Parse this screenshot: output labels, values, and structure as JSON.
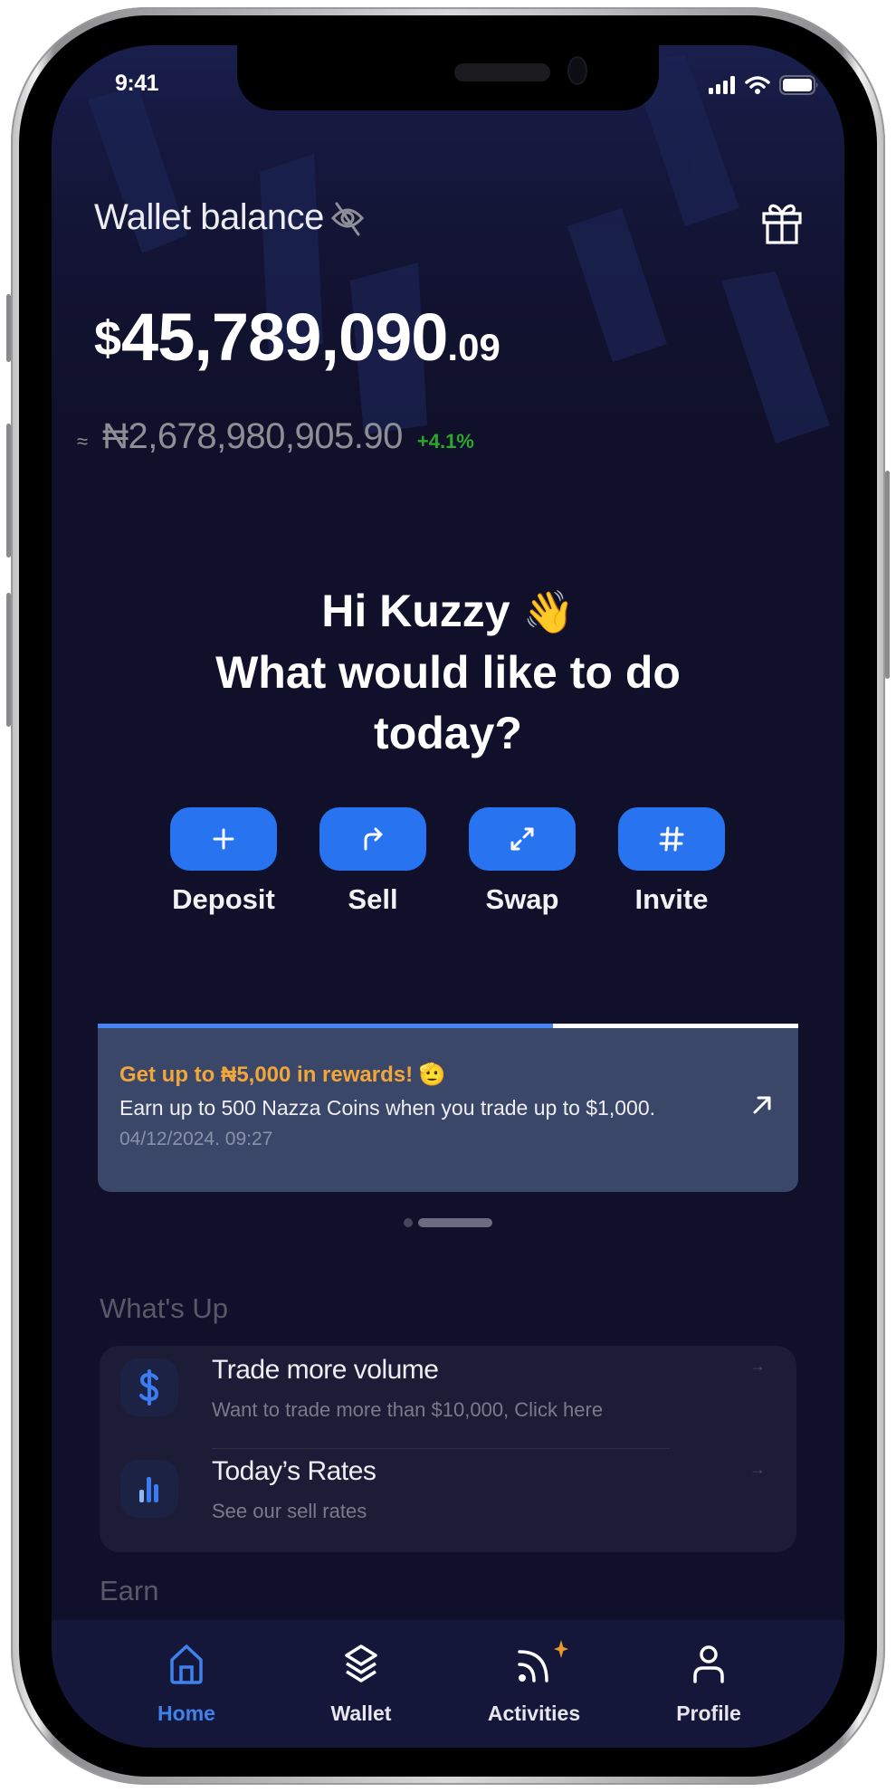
{
  "status_bar": {
    "time": "9:41",
    "icons": [
      "cellular-signal-icon",
      "wifi-icon",
      "battery-icon"
    ]
  },
  "header": {
    "wallet_label": "Wallet balance",
    "hide_icon": "eye-off-icon",
    "gift_icon": "gift-icon",
    "balance": {
      "currency": "$",
      "integer": "45,789,090",
      "decimal": ".09"
    },
    "ngn_prefix": "≈",
    "ngn_value": "₦2,678,980,905.90",
    "change": "+4.1%"
  },
  "greeting": {
    "line1": "Hi Kuzzy",
    "emoji": "👋",
    "line2": "What would like to do",
    "line3": "today?"
  },
  "actions": [
    {
      "label": "Deposit",
      "icon": "plus-icon"
    },
    {
      "label": "Sell",
      "icon": "share-arrow-icon"
    },
    {
      "label": "Swap",
      "icon": "expand-arrows-icon"
    },
    {
      "label": "Invite",
      "icon": "hash-icon"
    }
  ],
  "promo": {
    "progress": 0.65,
    "title": "Get up to ₦5,000 in rewards! 🫡",
    "text": "Earn up to 500 Nazza Coins when you trade up to $1,000.",
    "date": "04/12/2024. 09:27",
    "arrow_icon": "arrow-up-right-icon"
  },
  "carousel": {
    "count": 2,
    "active": 1
  },
  "whats_up": {
    "title": "What's Up",
    "items": [
      {
        "title": "Trade more volume",
        "subtitle": "Want to trade more than $10,000, Click here",
        "icon": "dollar-icon",
        "arrow": "→"
      },
      {
        "title": "Today’s Rates",
        "subtitle": "See our sell rates",
        "icon": "bar-chart-icon",
        "arrow": "→"
      }
    ]
  },
  "earn": {
    "title": "Earn"
  },
  "nav": {
    "items": [
      {
        "label": "Home",
        "icon": "home-icon",
        "active": true
      },
      {
        "label": "Wallet",
        "icon": "layers-icon",
        "active": false
      },
      {
        "label": "Activities",
        "icon": "rss-icon",
        "active": false,
        "badge": "sparkle"
      },
      {
        "label": "Profile",
        "icon": "user-icon",
        "active": false
      }
    ]
  },
  "colors": {
    "background": "#10102a",
    "accent": "#2873f0",
    "promo_card": "#3b4769",
    "promo_title": "#f2a63a",
    "positive": "#2aa829",
    "nav_active": "#3f82ec"
  }
}
